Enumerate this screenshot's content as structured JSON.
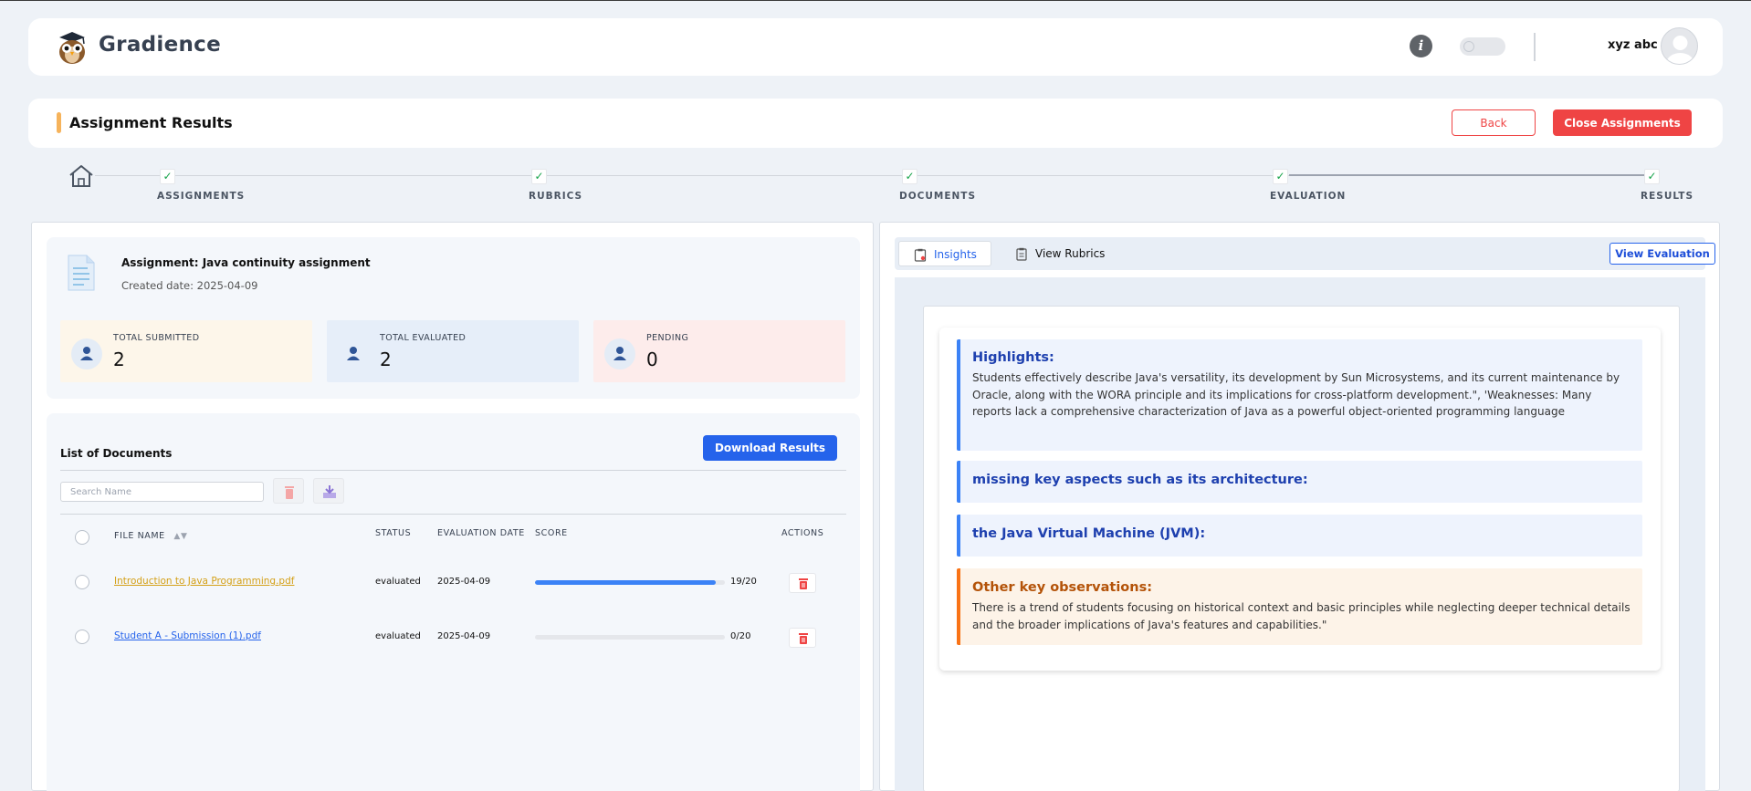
{
  "app": {
    "brand": "Gradience",
    "username": "xyz abc"
  },
  "page": {
    "title": "Assignment Results",
    "back_label": "Back",
    "close_label": "Close Assignments"
  },
  "stepper": {
    "steps": [
      {
        "label": "ASSIGNMENTS",
        "done": true
      },
      {
        "label": "RUBRICS",
        "done": true
      },
      {
        "label": "DOCUMENTS",
        "done": true
      },
      {
        "label": "EVALUATION",
        "done": true
      },
      {
        "label": "RESULTS",
        "done": true
      }
    ]
  },
  "assignment": {
    "name": "Assignment: Java continuity assignment",
    "created": "Created date: 2025-04-09",
    "stats": [
      {
        "label": "TOTAL SUBMITTED",
        "value": "2",
        "color": "#fdf6ea"
      },
      {
        "label": "TOTAL EVALUATED",
        "value": "2",
        "color": "#e6eef9"
      },
      {
        "label": "PENDING",
        "value": "0",
        "color": "#fdeceb"
      }
    ]
  },
  "documents": {
    "title": "List of Documents",
    "download_label": "Download Results",
    "search_placeholder": "Search Name",
    "columns": {
      "file": "FILE NAME",
      "status": "STATUS",
      "date": "EVALUATION DATE",
      "score": "SCORE",
      "actions": "ACTIONS"
    },
    "rows": [
      {
        "file": "Introduction to Java Programming.pdf",
        "status": "evaluated",
        "date": "2025-04-09",
        "score": "19/20",
        "fraction": 0.95,
        "link_color": "#d4a017"
      },
      {
        "file": "Student A - Submission (1).pdf",
        "status": "evaluated",
        "date": "2025-04-09",
        "score": "0/20",
        "fraction": 0,
        "link_color": "#2563eb"
      }
    ]
  },
  "insights": {
    "tab_insights": "Insights",
    "tab_rubrics": "View Rubrics",
    "view_evaluation": "View Evaluation",
    "highlights_head": "Highlights:",
    "highlights_text": "Students effectively describe Java's versatility, its development by Sun Microsystems, and its current maintenance by Oracle, along with the WORA principle and its implications for cross-platform development.\", 'Weaknesses: Many reports lack a comprehensive characterization of Java as a powerful object-oriented programming language",
    "missing_head": "missing key aspects such as its architecture:",
    "jvm_head": "the Java Virtual Machine (JVM):",
    "other_head": "Other key observations:",
    "other_text": "There is a trend of students focusing on historical context and basic principles while neglecting deeper technical details and the broader implications of Java's features and capabilities.\""
  }
}
